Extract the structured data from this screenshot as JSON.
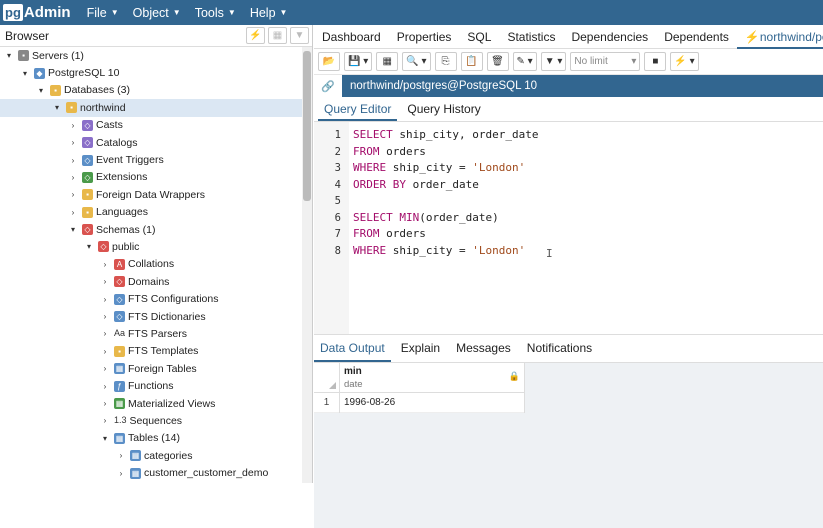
{
  "app": {
    "logo_pg": "pg",
    "logo_admin": "Admin"
  },
  "menu": [
    {
      "label": "File"
    },
    {
      "label": "Object"
    },
    {
      "label": "Tools"
    },
    {
      "label": "Help"
    }
  ],
  "browser": {
    "title": "Browser"
  },
  "tree": [
    {
      "label": "Servers (1)",
      "level": 0,
      "toggle": "▾"
    },
    {
      "label": "PostgreSQL 10",
      "level": 1,
      "toggle": "▾"
    },
    {
      "label": "Databases (3)",
      "level": 2,
      "toggle": "▾"
    },
    {
      "label": "northwind",
      "level": 3,
      "toggle": "▾",
      "selected": true
    },
    {
      "label": "Casts",
      "level": 4,
      "toggle": "›"
    },
    {
      "label": "Catalogs",
      "level": 4,
      "toggle": "›"
    },
    {
      "label": "Event Triggers",
      "level": 4,
      "toggle": "›"
    },
    {
      "label": "Extensions",
      "level": 4,
      "toggle": "›"
    },
    {
      "label": "Foreign Data Wrappers",
      "level": 4,
      "toggle": "›"
    },
    {
      "label": "Languages",
      "level": 4,
      "toggle": "›"
    },
    {
      "label": "Schemas (1)",
      "level": 4,
      "toggle": "▾"
    },
    {
      "label": "public",
      "level": 5,
      "toggle": "▾"
    },
    {
      "label": "Collations",
      "level": 6,
      "toggle": "›"
    },
    {
      "label": "Domains",
      "level": 6,
      "toggle": "›"
    },
    {
      "label": "FTS Configurations",
      "level": 6,
      "toggle": "›"
    },
    {
      "label": "FTS Dictionaries",
      "level": 6,
      "toggle": "›"
    },
    {
      "label": "FTS Parsers",
      "level": 6,
      "toggle": "›"
    },
    {
      "label": "FTS Templates",
      "level": 6,
      "toggle": "›"
    },
    {
      "label": "Foreign Tables",
      "level": 6,
      "toggle": "›"
    },
    {
      "label": "Functions",
      "level": 6,
      "toggle": "›"
    },
    {
      "label": "Materialized Views",
      "level": 6,
      "toggle": "›"
    },
    {
      "label": "Sequences",
      "level": 6,
      "toggle": "›"
    },
    {
      "label": "Tables (14)",
      "level": 6,
      "toggle": "▾"
    },
    {
      "label": "categories",
      "level": 7,
      "toggle": "›"
    },
    {
      "label": "customer_customer_demo",
      "level": 7,
      "toggle": "›"
    }
  ],
  "tabs": [
    {
      "label": "Dashboard"
    },
    {
      "label": "Properties"
    },
    {
      "label": "SQL"
    },
    {
      "label": "Statistics"
    },
    {
      "label": "Dependencies"
    },
    {
      "label": "Dependents"
    },
    {
      "label": "northwind/postgr"
    }
  ],
  "toolbar": {
    "limit": "No limit"
  },
  "connection": {
    "label": "northwind/postgres@PostgreSQL 10"
  },
  "editor_tabs": [
    {
      "label": "Query Editor"
    },
    {
      "label": "Query History"
    }
  ],
  "sql_lines": [
    "SELECT ship_city, order_date",
    "FROM orders",
    "WHERE ship_city = 'London'",
    "ORDER BY order_date",
    "",
    "SELECT MIN(order_date)",
    "FROM orders",
    "WHERE ship_city = 'London'"
  ],
  "output_tabs": [
    {
      "label": "Data Output"
    },
    {
      "label": "Explain"
    },
    {
      "label": "Messages"
    },
    {
      "label": "Notifications"
    }
  ],
  "result": {
    "column_name": "min",
    "column_type": "date",
    "rows": [
      {
        "num": "1",
        "value": "1996-08-26"
      }
    ]
  }
}
